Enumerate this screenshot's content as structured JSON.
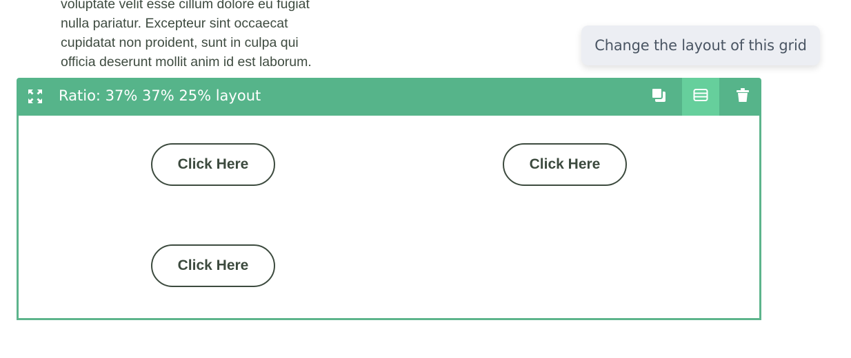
{
  "paragraph": {
    "lines": [
      "voluptate velit esse cillum dolore eu fugiat",
      "nulla pariatur. Excepteur sint occaecat",
      "cupidatat non proident, sunt in culpa qui",
      "officia deserunt mollit anim id est laborum."
    ]
  },
  "tooltip": {
    "text": "Change the layout of this grid"
  },
  "grid": {
    "title": "Ratio: 37% 37% 25% layout",
    "toolbar_icons": {
      "expand": "expand-arrows-icon",
      "duplicate": "duplicate-icon",
      "layout": "grid-layout-icon",
      "delete": "trash-icon"
    },
    "buttons": [
      {
        "label": "Click Here"
      },
      {
        "label": "Click Here"
      },
      {
        "label": "Click Here"
      }
    ]
  },
  "colors": {
    "toolbar": "#56b48a",
    "toolbar_active": "#66cf9c",
    "border": "#5db48c",
    "text_dark": "#3c4a3e",
    "tooltip_bg": "#eceef3"
  }
}
